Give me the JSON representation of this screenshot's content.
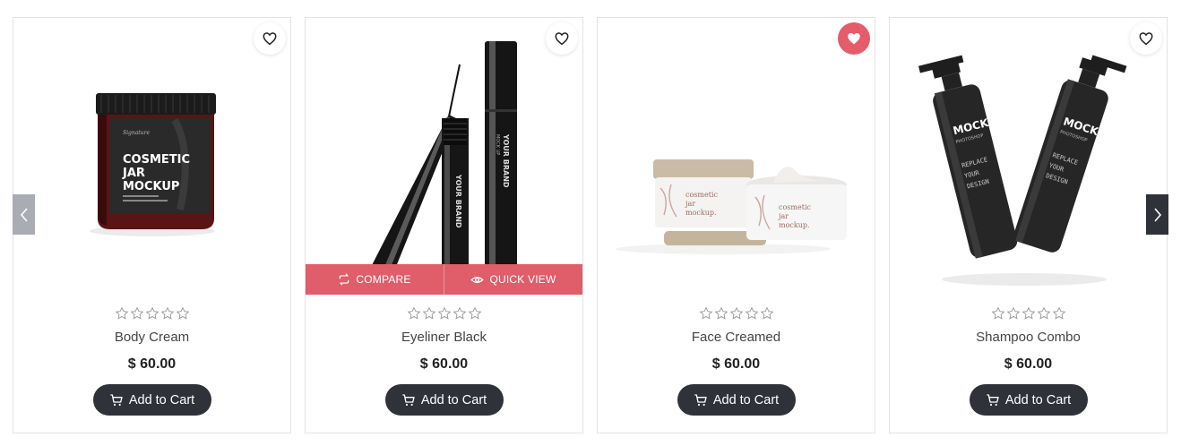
{
  "products": [
    {
      "name": "Body Cream",
      "price": "$ 60.00",
      "rating": 0,
      "wishlisted": false,
      "cart_label": "Add to Cart",
      "image_labels": {
        "line1": "COSMETIC",
        "line2": "JAR",
        "line3": "MOCKUP"
      }
    },
    {
      "name": "Eyeliner Black",
      "price": "$ 60.00",
      "rating": 0,
      "wishlisted": false,
      "cart_label": "Add to Cart",
      "image_labels": {
        "brand": "YOUR BRAND",
        "small": "MOCK UP"
      },
      "actions": {
        "compare": "COMPARE",
        "quick_view": "QUICK VIEW"
      }
    },
    {
      "name": "Face Creamed",
      "price": "$ 60.00",
      "rating": 0,
      "wishlisted": true,
      "cart_label": "Add to Cart",
      "image_labels": {
        "line1": "cosmetic",
        "line2": "jar",
        "line3": "mockup."
      }
    },
    {
      "name": "Shampoo Combo",
      "price": "$ 60.00",
      "rating": 0,
      "wishlisted": false,
      "cart_label": "Add to Cart",
      "image_labels": {
        "brand": "MOCKUP",
        "sub": "PHOTOSHOP",
        "l1": "REPLACE",
        "l2": "YOUR",
        "l3": "DESIGN"
      }
    }
  ],
  "colors": {
    "accent": "#e05d6a",
    "dark_button": "#2f3238",
    "star_outline": "#9a9a9a"
  },
  "icons": {
    "wishlist": "heart-icon",
    "cart": "cart-icon",
    "compare": "compare-arrows-icon",
    "quick_view": "eye-icon",
    "prev": "chevron-left-icon",
    "next": "chevron-right-icon"
  }
}
